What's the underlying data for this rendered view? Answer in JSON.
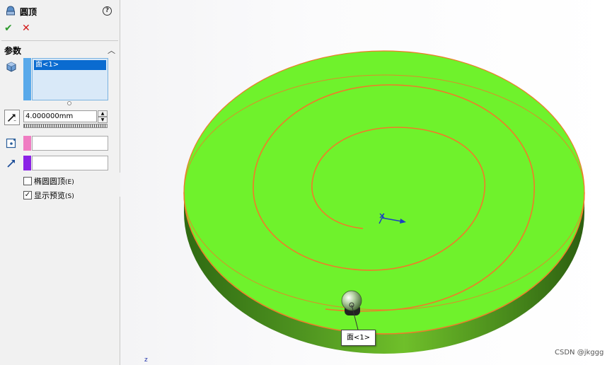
{
  "panel": {
    "title": "圆顶",
    "help_glyph": "?",
    "ok_glyph": "✔",
    "cancel_glyph": "✕",
    "section_title": "参数",
    "collapse_glyph": "︿",
    "selection": {
      "item": "面<1>"
    },
    "distance": {
      "value": "4.000000mm"
    },
    "elliptical_dome": {
      "label": "椭圆圆顶",
      "shortcut": "(E)",
      "checked": false,
      "glyph": ""
    },
    "show_preview": {
      "label": "显示预览",
      "shortcut": "(S)",
      "checked": true,
      "glyph": "✓"
    }
  },
  "viewport": {
    "face_tag": "面<1>",
    "z_label": "z"
  },
  "watermark": "CSDN @jkggg",
  "colors": {
    "face_green": "#6ff22c",
    "side_green": "#4b8f1a",
    "edge_orange": "#f07a2a",
    "selection_blue": "#0a6bd0",
    "strip_blue": "#59a9ea",
    "strip_pink": "#ef7cc2",
    "strip_purple": "#8a22e6"
  }
}
